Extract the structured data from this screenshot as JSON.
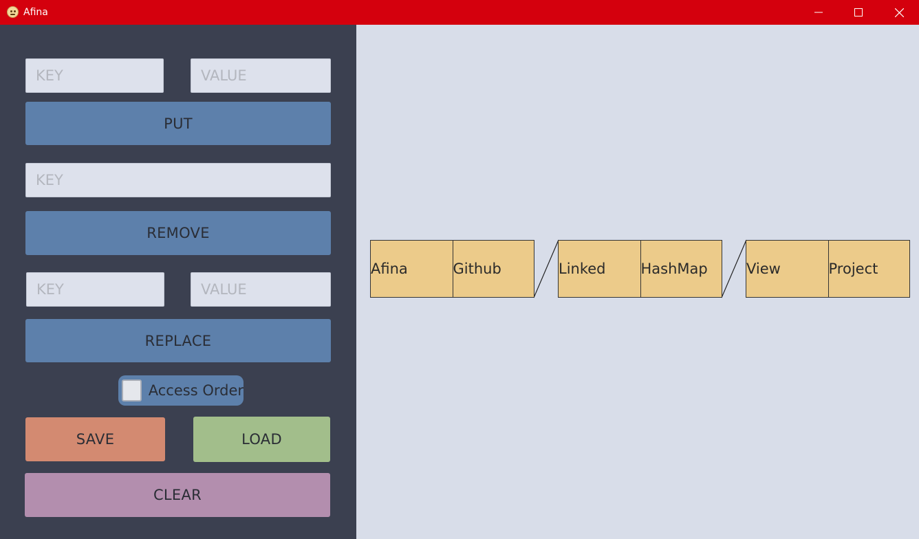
{
  "window": {
    "title": "Afina",
    "controls": {
      "minimize": "minimize-icon",
      "maximize": "maximize-icon",
      "close": "close-icon"
    }
  },
  "sidebar": {
    "put": {
      "key_placeholder": "KEY",
      "value_placeholder": "VALUE",
      "button_label": "PUT"
    },
    "remove": {
      "key_placeholder": "KEY",
      "button_label": "REMOVE"
    },
    "replace": {
      "key_placeholder": "KEY",
      "value_placeholder": "VALUE",
      "button_label": "REPLACE"
    },
    "access_order": {
      "label": "Access Order",
      "checked": false
    },
    "save_label": "SAVE",
    "load_label": "LOAD",
    "clear_label": "CLEAR"
  },
  "map_view": {
    "nodes": [
      {
        "key": "Afina",
        "value": "Github"
      },
      {
        "key": "Linked",
        "value": "HashMap"
      },
      {
        "key": "View",
        "value": "Project"
      }
    ]
  },
  "colors": {
    "titlebar": "#d4000d",
    "sidebar_bg": "#3b4050",
    "canvas_bg": "#d8dde9",
    "button_blue": "#5d80ab",
    "save": "#d38a71",
    "load": "#a2be8b",
    "clear": "#b38eae",
    "node_fill": "#eccb8a"
  }
}
